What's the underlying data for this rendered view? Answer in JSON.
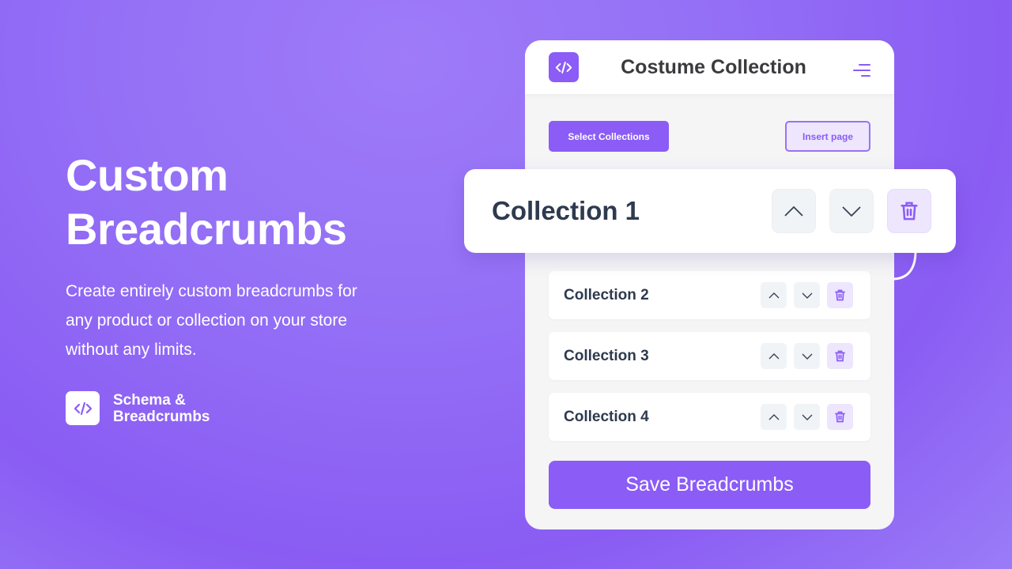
{
  "hero": {
    "title_line1": "Custom",
    "title_line2": "Breadcrumbs",
    "description": "Create entirely custom breadcrumbs for any product or collection on your store without any limits.",
    "brand_line1": "Schema &",
    "brand_line2": "Breadcrumbs",
    "brand_icon": "code-icon"
  },
  "panel": {
    "title": "Costume Collection",
    "logo_icon": "code-icon",
    "menu_icon": "menu-icon",
    "select_button": "Select Collections",
    "insert_button": "Insert page",
    "highlighted_item": "Collection 1",
    "items": [
      {
        "label": "Collection 2"
      },
      {
        "label": "Collection 3"
      },
      {
        "label": "Collection 4"
      }
    ],
    "save_button": "Save Breadcrumbs"
  },
  "colors": {
    "accent": "#8b5cf6",
    "accent_light": "#ede6fd",
    "text_dark": "#2e3a4e",
    "background": "#9470f6"
  }
}
